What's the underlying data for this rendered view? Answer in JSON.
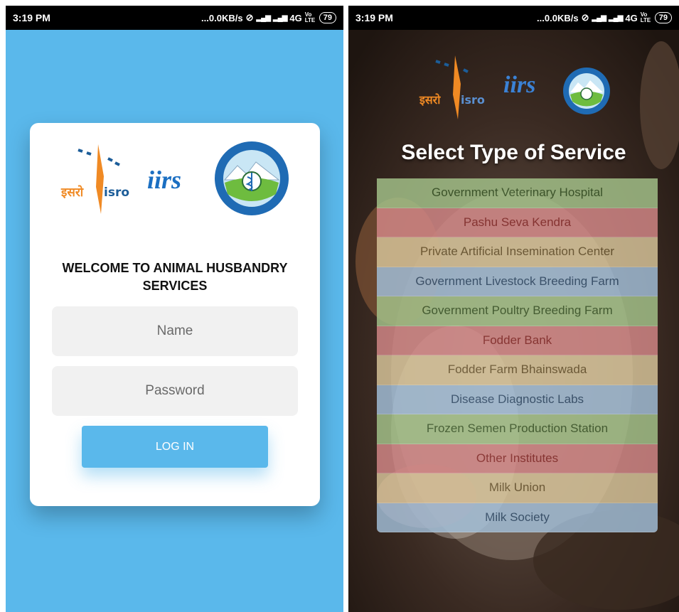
{
  "left_screen": {
    "status": {
      "time": "3:19 PM",
      "net": "...0.0KB/s",
      "net_type": "4G",
      "volte": "Vo LTE",
      "battery": "79"
    },
    "logos": {
      "isro_hindi": "इसरो",
      "isro_en": "isro",
      "iirs": "iirs",
      "dept_seal_text": "पशुपालन विभाग उत्तराखंड · Department of Animal Husbandry Uttarakhand"
    },
    "welcome": "WELCOME TO ANIMAL HUSBANDRY SERVICES",
    "name_placeholder": "Name",
    "password_placeholder": "Password",
    "login_label": "LOG IN",
    "accent": "#5ab8eb"
  },
  "right_screen": {
    "status": {
      "time": "3:19 PM",
      "net": "...0.0KB/s",
      "net_type": "4G",
      "volte": "Vo LTE",
      "battery": "79"
    },
    "logos": {
      "isro_hindi": "इसरो",
      "isro_en": "isro",
      "iirs": "iirs"
    },
    "title": "Select Type of Service",
    "services": [
      {
        "label": "Government Veterinary Hospital",
        "bg": "#a5c48b",
        "color": "#3a5a2a"
      },
      {
        "label": "Pashu Seva Kendra",
        "bg": "#d48888",
        "color": "#8a2a2a"
      },
      {
        "label": "Private Artificial Insemination Center",
        "bg": "#d9c69b",
        "color": "#6a5730"
      },
      {
        "label": "Government Livestock Breeding Farm",
        "bg": "#a3c0da",
        "color": "#2f4e6e"
      },
      {
        "label": "Government Poultry Breeding Farm",
        "bg": "#a5c48b",
        "color": "#3a5a2a"
      },
      {
        "label": "Fodder Bank",
        "bg": "#d48888",
        "color": "#8a2a2a"
      },
      {
        "label": "Fodder Farm Bhainswada",
        "bg": "#d9c69b",
        "color": "#6a5730"
      },
      {
        "label": "Disease Diagnostic Labs",
        "bg": "#a3c0da",
        "color": "#2f4e6e"
      },
      {
        "label": "Frozen Semen Production Station",
        "bg": "#a5c48b",
        "color": "#3a5a2a"
      },
      {
        "label": "Other Institutes",
        "bg": "#d48888",
        "color": "#8a2a2a"
      },
      {
        "label": "Milk Union",
        "bg": "#d9c69b",
        "color": "#6a5730"
      },
      {
        "label": "Milk Society",
        "bg": "#a3c0da",
        "color": "#2f4e6e"
      }
    ]
  }
}
